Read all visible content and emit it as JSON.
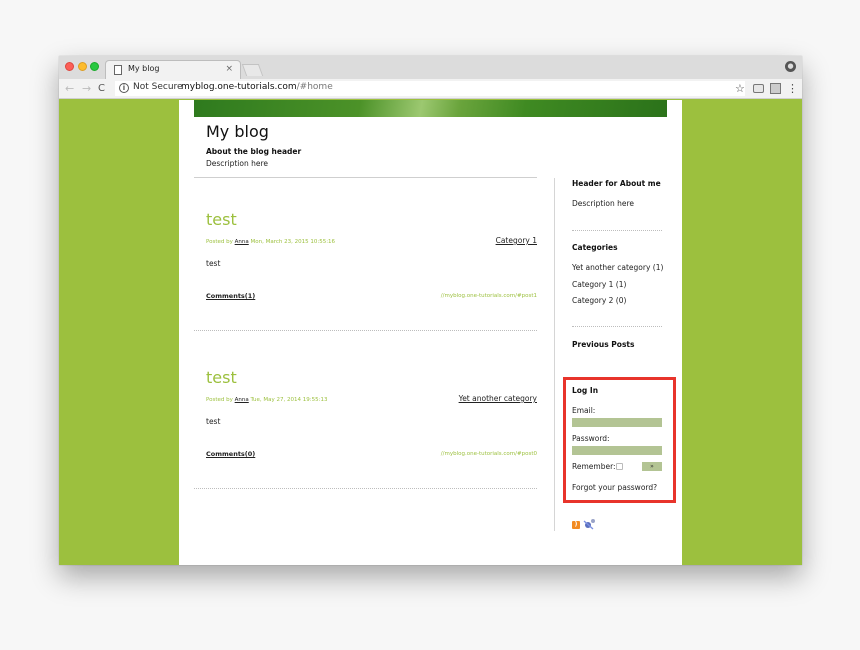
{
  "browser": {
    "tab_title": "My blog",
    "tab_close": "×",
    "not_secure": "Not Secure",
    "url_host": "myblog.one-tutorials.com",
    "url_path": "/#home",
    "icons": [
      "page-icon",
      "close-icon",
      "back-arrow-icon",
      "forward-arrow-icon",
      "reload-icon",
      "info-icon",
      "star-icon",
      "camera-icon",
      "extension-icon",
      "menu-icon",
      "profile-icon"
    ]
  },
  "blog": {
    "title": "My blog",
    "about_header": "About the blog header",
    "description": "Description here"
  },
  "posts": [
    {
      "title": "test",
      "meta_prefix": "Posted by ",
      "author": "Anna",
      "date": " Mon, March 23, 2015 10:55:16",
      "category": "Category 1",
      "body": "test",
      "comments": "Comments(1)",
      "permalink": "//myblog.one-tutorials.com/#post1"
    },
    {
      "title": "test",
      "meta_prefix": "Posted by ",
      "author": "Anna",
      "date": " Tue, May 27, 2014 19:55:13",
      "category": "Yet another category",
      "body": "test",
      "comments": "Comments(0)",
      "permalink": "//myblog.one-tutorials.com/#post0"
    }
  ],
  "sidebar": {
    "about_header": "Header for About me",
    "about_desc": "Description here",
    "categories_header": "Categories",
    "categories": [
      "Yet another category (1)",
      "Category 1 (1)",
      "Category 2 (0)"
    ],
    "previous_posts": "Previous Posts",
    "login": {
      "header": "Log In",
      "email_label": "Email:",
      "password_label": "Password:",
      "remember_label": "Remember:",
      "submit": "»",
      "forgot": "Forgot your password?"
    },
    "feed_icons": [
      "rss-icon",
      "atom-feed-icon"
    ]
  },
  "colors": {
    "accent": "#9cc03e",
    "login_highlight": "#e8342b",
    "input_bg": "#b3c494"
  }
}
